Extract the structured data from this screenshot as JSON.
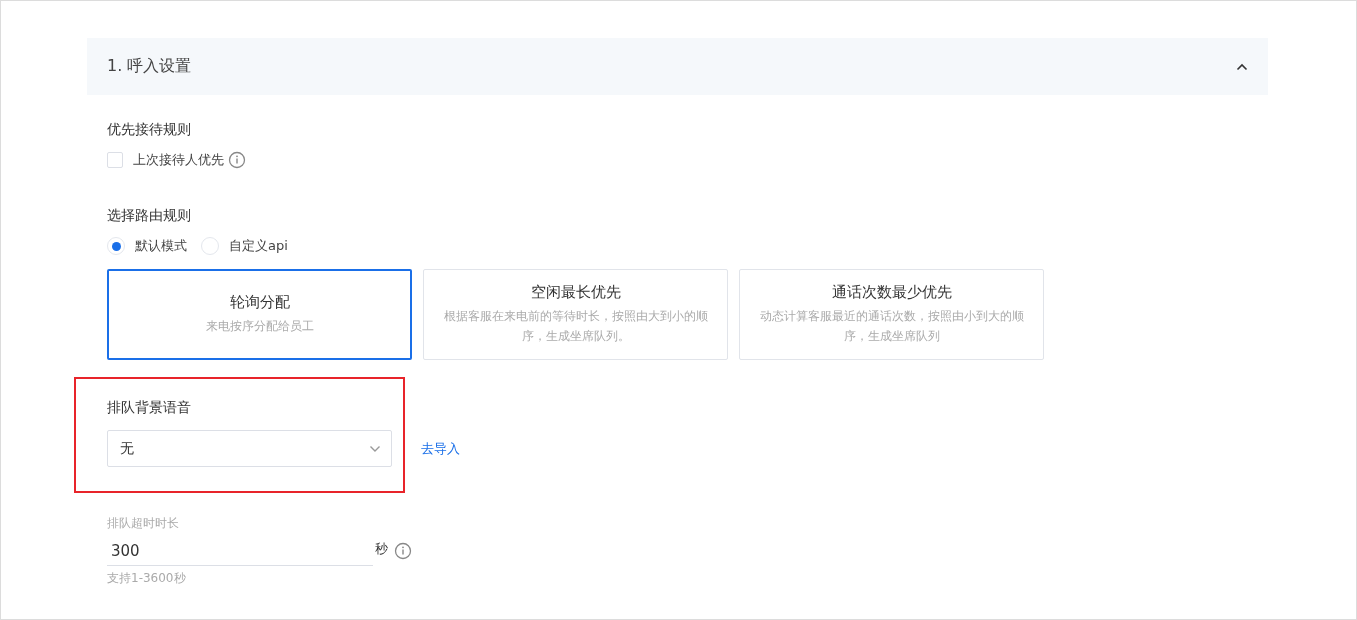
{
  "section": {
    "title": "1. 呼入设置",
    "expanded": true
  },
  "priority": {
    "label": "优先接待规则",
    "checkbox": {
      "label": "上次接待人优先",
      "checked": false
    }
  },
  "routing": {
    "label": "选择路由规则",
    "modes": [
      {
        "label": "默认模式",
        "selected": true
      },
      {
        "label": "自定义api",
        "selected": false
      }
    ],
    "strategies": [
      {
        "title": "轮询分配",
        "description": "来电按序分配给员工",
        "selected": true
      },
      {
        "title": "空闲最长优先",
        "description": "根据客服在来电前的等待时长，按照由大到小的顺序，生成坐席队列。",
        "selected": false
      },
      {
        "title": "通话次数最少优先",
        "description": "动态计算客服最近的通话次数，按照由小到大的顺序，生成坐席队列",
        "selected": false
      }
    ]
  },
  "queue_audio": {
    "label": "排队背景语音",
    "value": "无",
    "link": "去导入",
    "highlighted": true
  },
  "queue_timeout": {
    "label": "排队超时时长",
    "value": "300",
    "unit": "秒",
    "hint": "支持1-3600秒"
  }
}
